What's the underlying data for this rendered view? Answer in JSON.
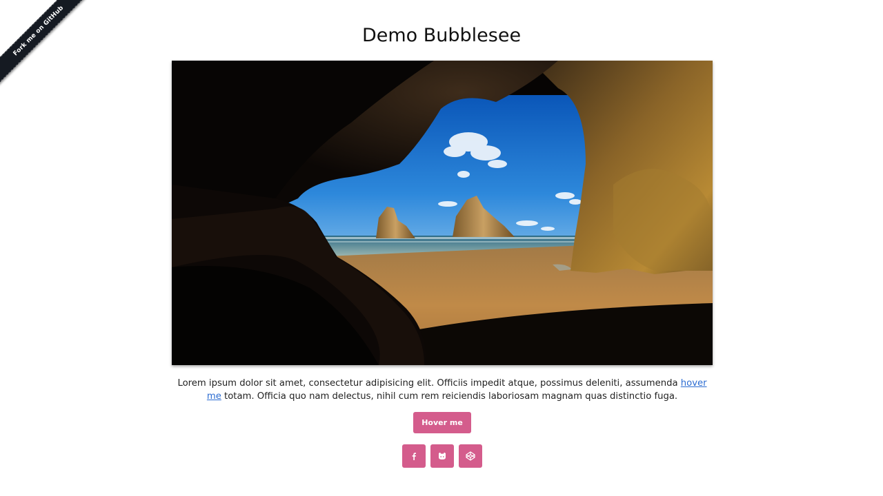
{
  "ribbon": {
    "label": "Fork me on GitHub",
    "color": "#151a22"
  },
  "page_title": "Demo Bubblesee",
  "hero_image": {
    "subject": "sea cave arch opening onto a beach with rock stacks and blue sky"
  },
  "description": {
    "text_before": "Lorem ipsum dolor sit amet, consectetur adipisicing elit. Officiis impedit atque, possimus deleniti, assumenda ",
    "link": "hover me",
    "text_after": " totam. Officia quo nam delectus, nihil cum rem reiciendis laboriosam magnam quas distinctio fuga."
  },
  "primary_button": {
    "label": "Hover me"
  },
  "social_buttons": [
    {
      "icon": "facebook-icon"
    },
    {
      "icon": "github-icon"
    },
    {
      "icon": "codepen-icon"
    }
  ],
  "colors": {
    "accent": "#d45c8c",
    "link": "#2a6bd1"
  }
}
